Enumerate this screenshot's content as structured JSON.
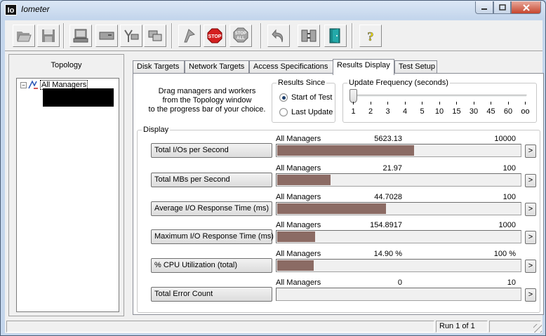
{
  "window": {
    "title": "Iometer",
    "icon_text": "Io"
  },
  "toolbar": {
    "buttons": [
      {
        "name": "open-config-button",
        "icon": "folder-open-icon"
      },
      {
        "name": "save-config-button",
        "icon": "floppy-disk-icon"
      },
      {
        "name": "start-disk-worker-button",
        "icon": "disk-worker-icon"
      },
      {
        "name": "start-network-worker-button",
        "icon": "network-worker-icon"
      },
      {
        "name": "add-manager-button",
        "icon": "manager-tree-icon"
      },
      {
        "name": "copy-worker-button",
        "icon": "copy-worker-icon"
      },
      {
        "name": "start-tests-button",
        "icon": "green-flag-icon"
      },
      {
        "name": "stop-test-button",
        "icon": "stop-sign-icon",
        "label": "STOP"
      },
      {
        "name": "stop-all-button",
        "icon": "stop-all-sign-icon",
        "label": "STOP",
        "label2": "ALL"
      },
      {
        "name": "reset-workers-button",
        "icon": "reset-arrow-icon"
      },
      {
        "name": "disconnect-workers-button",
        "icon": "disconnect-icon"
      },
      {
        "name": "exit-button",
        "icon": "exit-door-icon"
      },
      {
        "name": "help-button",
        "icon": "help-question-icon",
        "label": "?"
      }
    ]
  },
  "topology": {
    "title": "Topology",
    "tree": {
      "expander": "−",
      "root_label": "All Managers"
    }
  },
  "tabs": [
    {
      "label": "Disk Targets",
      "active": false
    },
    {
      "label": "Network Targets",
      "active": false
    },
    {
      "label": "Access Specifications",
      "active": false
    },
    {
      "label": "Results Display",
      "active": true
    },
    {
      "label": "Test Setup",
      "active": false
    }
  ],
  "results": {
    "instructions": [
      "Drag managers and workers",
      "from the Topology window",
      "to the progress bar of your choice."
    ],
    "results_since": {
      "title": "Results Since",
      "options": [
        {
          "label": "Start of Test",
          "selected": true
        },
        {
          "label": "Last Update",
          "selected": false
        }
      ]
    },
    "update_frequency": {
      "title": "Update Frequency (seconds)",
      "ticks": [
        "1",
        "2",
        "3",
        "4",
        "5",
        "10",
        "15",
        "30",
        "45",
        "60",
        "oo"
      ],
      "selected_index": 0
    },
    "display": {
      "title": "Display",
      "metrics": [
        {
          "label": "Total I/Os per Second",
          "source": "All Managers",
          "value": "5623.13",
          "max": "10000",
          "fraction": 0.5623
        },
        {
          "label": "Total MBs per Second",
          "source": "All Managers",
          "value": "21.97",
          "max": "100",
          "fraction": 0.2197
        },
        {
          "label": "Average I/O Response Time (ms)",
          "source": "All Managers",
          "value": "44.7028",
          "max": "100",
          "fraction": 0.447
        },
        {
          "label": "Maximum I/O Response Time (ms)",
          "source": "All Managers",
          "value": "154.8917",
          "max": "1000",
          "fraction": 0.1549
        },
        {
          "label": "% CPU Utilization (total)",
          "source": "All Managers",
          "value": "14.90 %",
          "max": "100 %",
          "fraction": 0.149
        },
        {
          "label": "Total Error Count",
          "source": "All Managers",
          "value": "0",
          "max": "10",
          "fraction": 0
        }
      ],
      "more_label": ">"
    }
  },
  "status": {
    "pane1": "",
    "run": "Run 1 of 1",
    "pane3": ""
  },
  "colors": {
    "bar": "#8b6b64",
    "stop_red": "#d42020",
    "exit_teal": "#1a8a8a",
    "help_yellow": "#f5e400"
  }
}
